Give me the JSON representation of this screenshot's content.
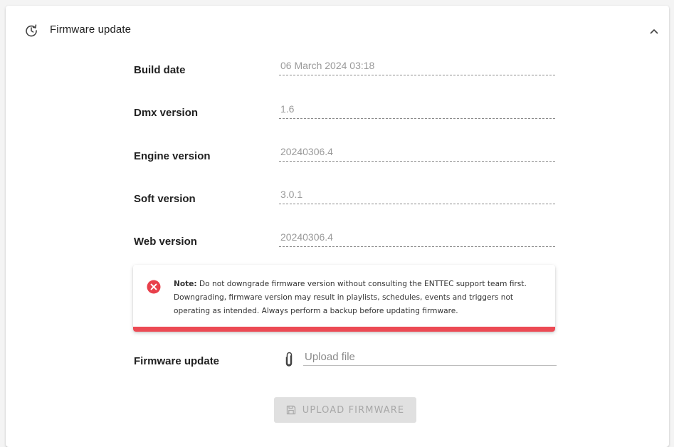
{
  "header": {
    "title": "Firmware update",
    "icon": "history-icon",
    "toggle_icon": "chevron-up-icon"
  },
  "rows": [
    {
      "label": "Build date",
      "value": "06 March 2024 03:18"
    },
    {
      "label": "Dmx version",
      "value": "1.6"
    },
    {
      "label": "Engine version",
      "value": "20240306.4"
    },
    {
      "label": "Soft version",
      "value": "3.0.1"
    },
    {
      "label": "Web version",
      "value": "20240306.4"
    }
  ],
  "alert": {
    "icon": "error-circle-icon",
    "lead": "Note:",
    "text": " Do not downgrade firmware version without consulting the ENTTEC support team first. Downgrading, firmware version may result in playlists, schedules, events and triggers not operating as intended. Always perform a backup before updating firmware.",
    "accent_color": "#ec4a54"
  },
  "upload": {
    "label": "Firmware update",
    "placeholder": "Upload file",
    "value": "",
    "icon": "paperclip-icon"
  },
  "button": {
    "label": "UPLOAD FIRMWARE",
    "icon": "save-icon",
    "disabled": true
  }
}
